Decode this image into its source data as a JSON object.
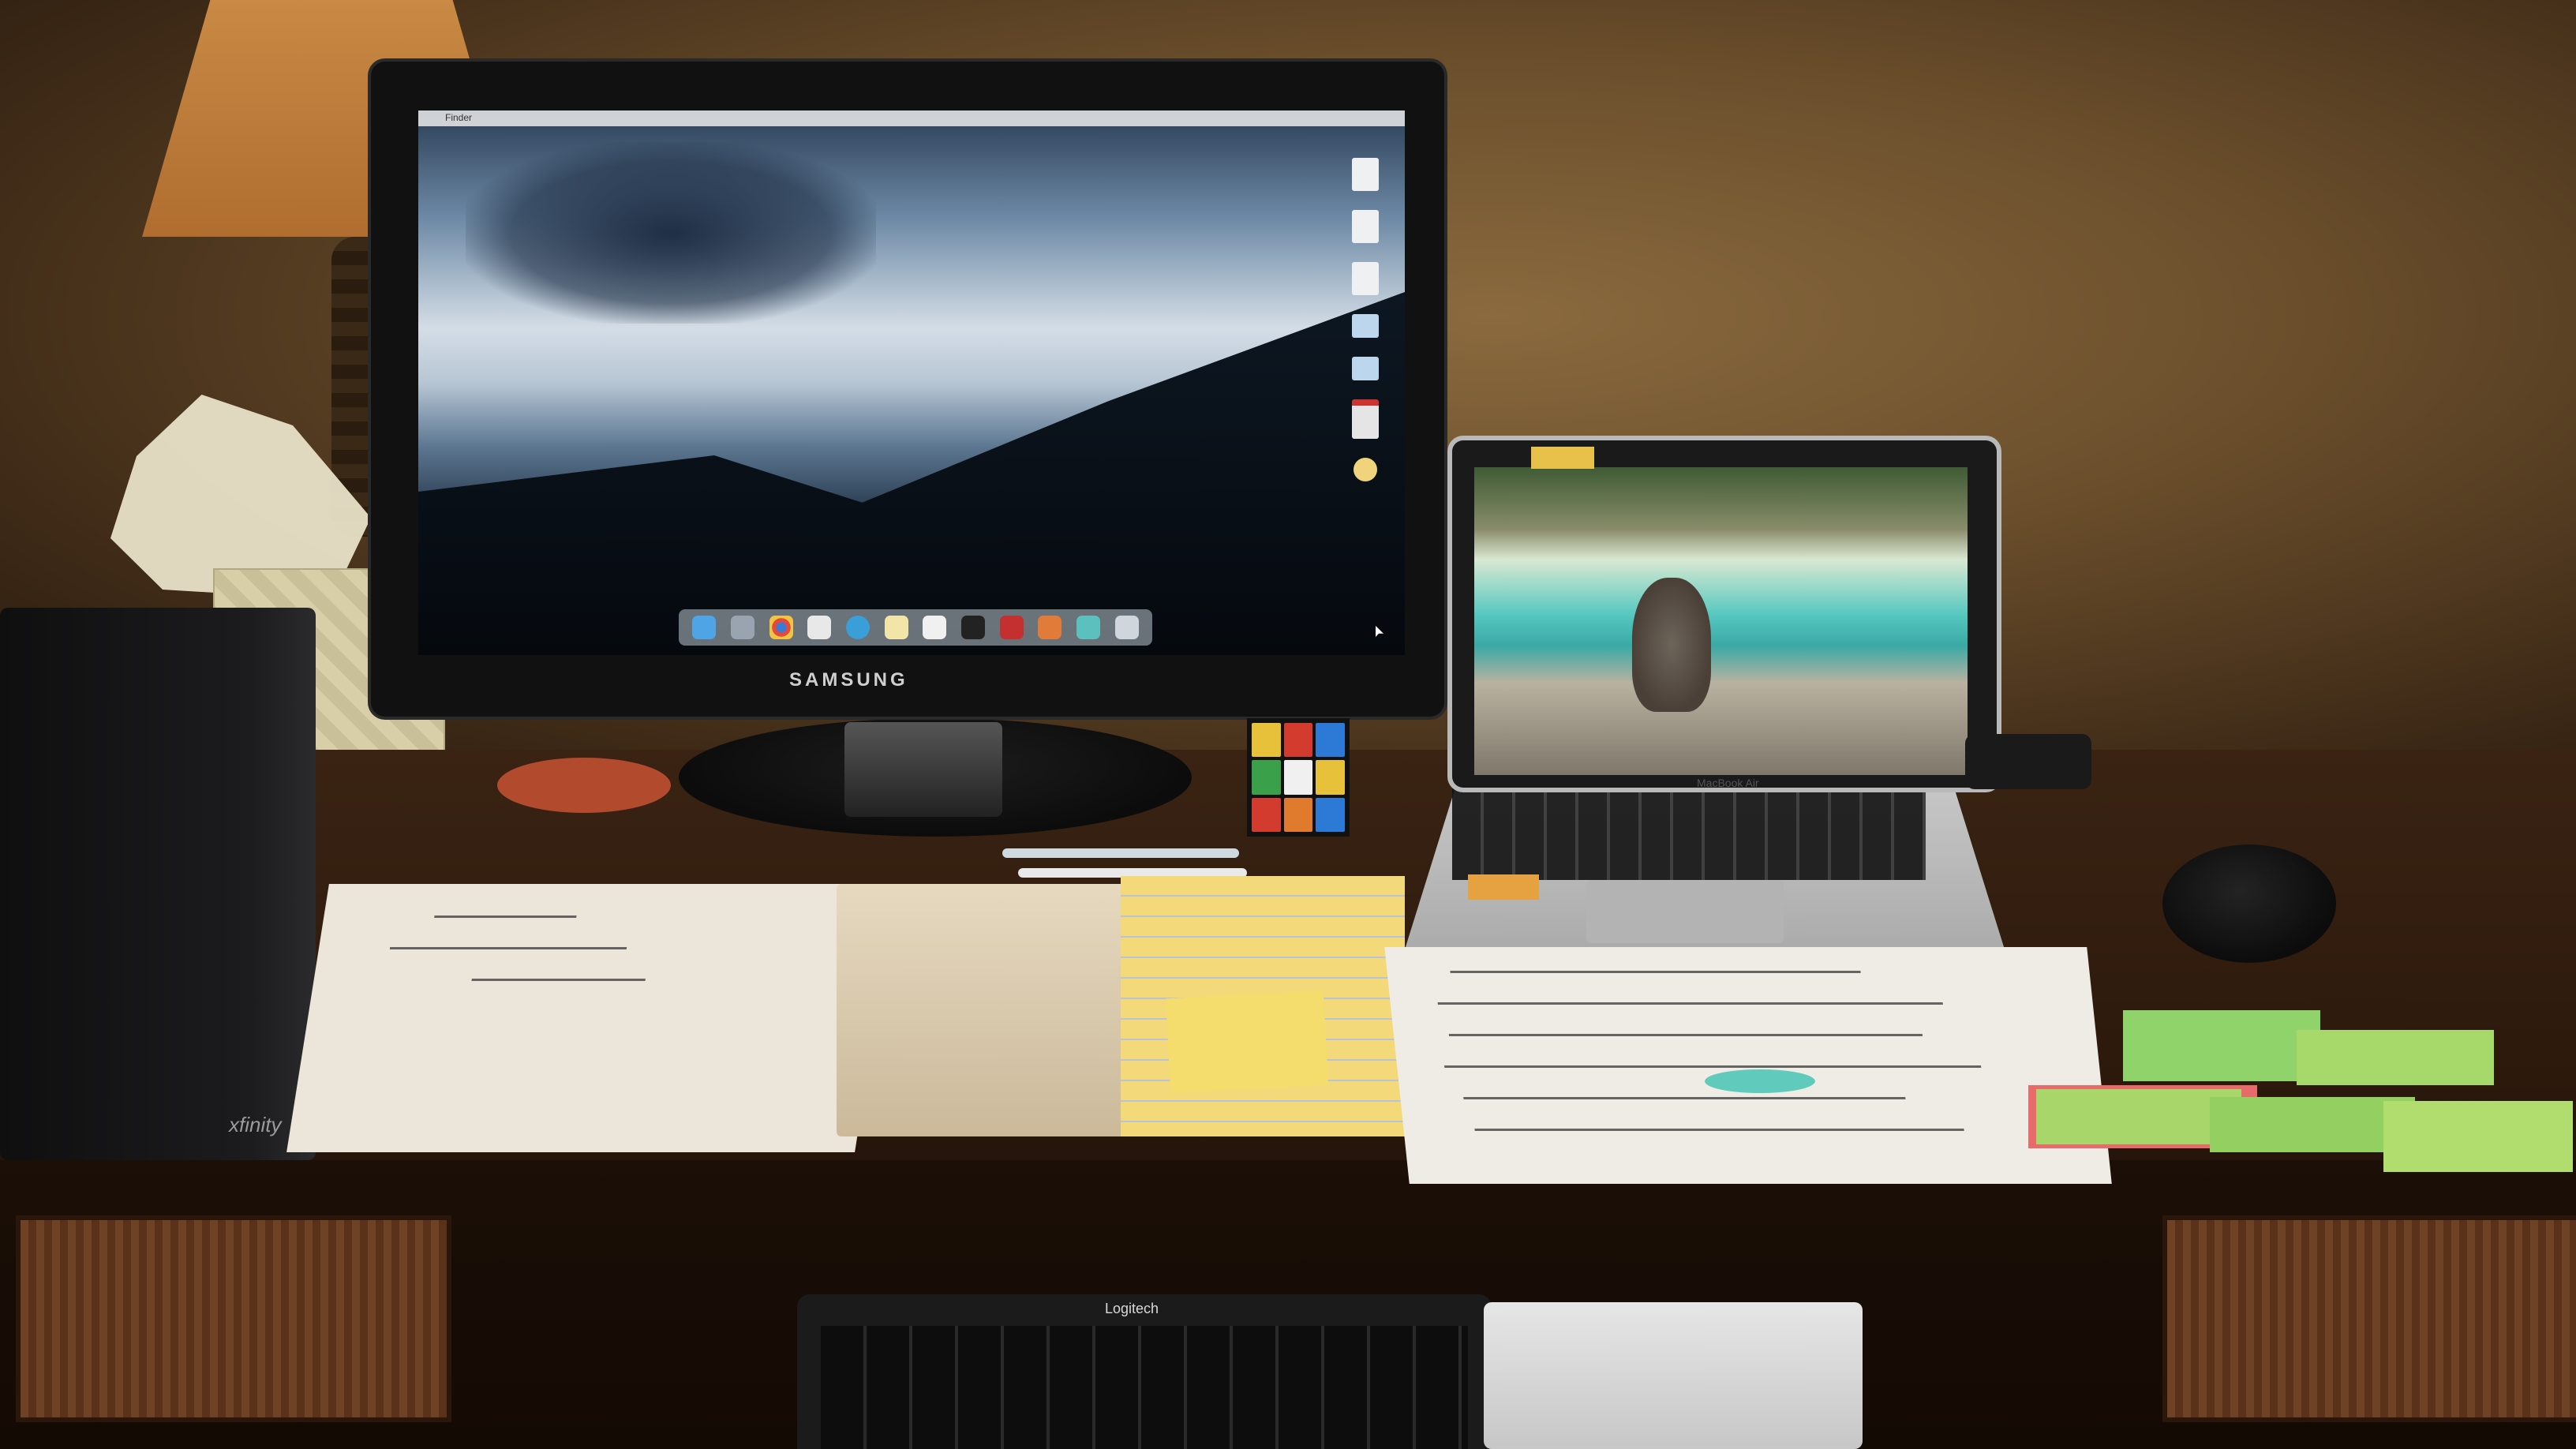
{
  "scene": {
    "monitor_brand": "SAMSUNG",
    "laptop_label": "MacBook Air",
    "keyboard_brand": "Logitech",
    "router_brand": "xfinity",
    "monitor_menubar": "Finder"
  },
  "colors": {
    "wall": "#6b4f2c",
    "desk": "#2c190c",
    "yellow_pad": "#f3d97a",
    "sticky_green": "#8fd36a",
    "sticky_red": "#e86b6b",
    "highlight": "#3cc3b1"
  },
  "dock_icons": [
    "finder-icon",
    "launchpad-icon",
    "chrome-icon",
    "files-icon",
    "safari-icon",
    "notes-icon",
    "photos-icon",
    "terminal-icon",
    "trash-icon"
  ],
  "desktop_icons": [
    "document-icon",
    "document-icon",
    "document-icon",
    "folder-icon",
    "folder-icon",
    "pdf-icon",
    "app-icon"
  ]
}
